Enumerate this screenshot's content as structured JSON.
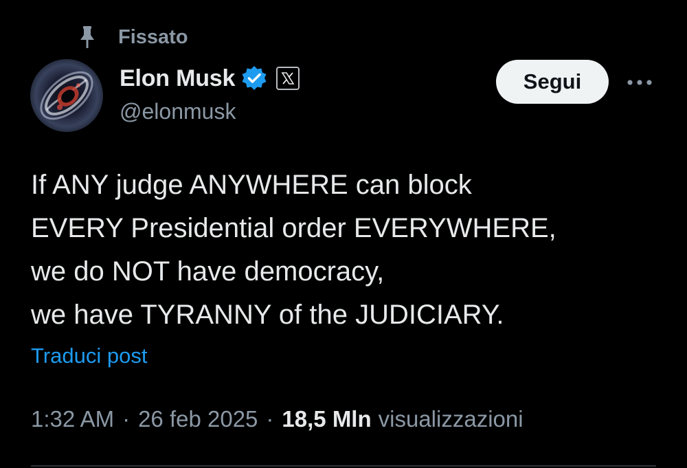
{
  "pinned": {
    "icon": "pin-icon",
    "label": "Fissato"
  },
  "author": {
    "display_name": "Elon Musk",
    "handle": "@elonmusk",
    "verified_icon": "verified-check-icon",
    "affiliate_icon": "x-logo-icon",
    "avatar": "avatar"
  },
  "actions": {
    "follow_label": "Segui",
    "more_icon": "more-horizontal-icon"
  },
  "tweet": {
    "lines": [
      "If ANY judge ANYWHERE can block",
      "EVERY Presidential order EVERYWHERE,",
      "we do NOT have democracy,",
      "we have TYRANNY of the JUDICIARY."
    ],
    "translate_label": "Traduci post"
  },
  "meta": {
    "time": "1:32 AM",
    "separator": "·",
    "date": "26 feb 2025",
    "views_count": "18,5 Mln",
    "views_label": "visualizzazioni"
  },
  "colors": {
    "background": "#000000",
    "text_primary": "#e7e9ea",
    "text_secondary": "#8b98a5",
    "link": "#1d9bf0",
    "verified": "#1d9bf0",
    "follow_bg": "#eff3f4"
  }
}
